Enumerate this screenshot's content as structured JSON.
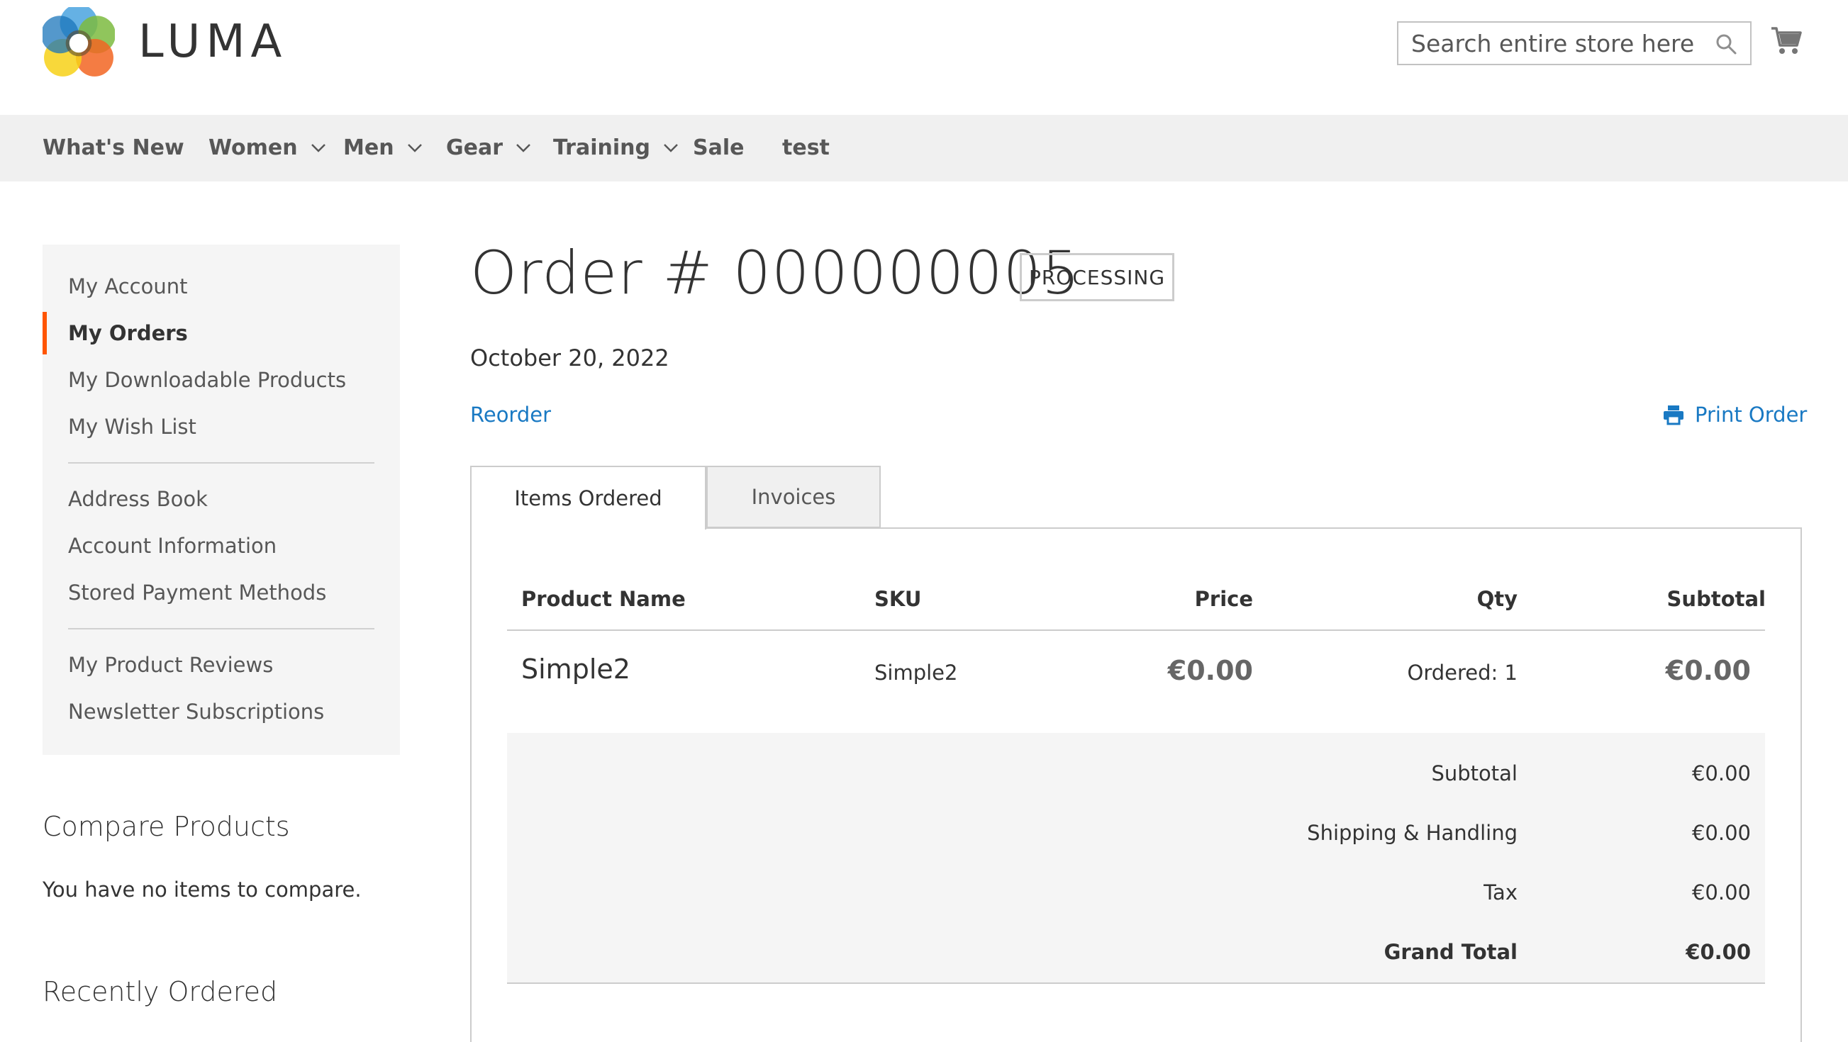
{
  "header": {
    "logo_text": "LUMA",
    "search_placeholder": "Search entire store here...",
    "search_icon": "search-icon",
    "cart_icon": "cart-icon"
  },
  "nav": {
    "items": [
      {
        "label": "What's New",
        "has_dropdown": false
      },
      {
        "label": "Women",
        "has_dropdown": true
      },
      {
        "label": "Men",
        "has_dropdown": true
      },
      {
        "label": "Gear",
        "has_dropdown": true
      },
      {
        "label": "Training",
        "has_dropdown": true
      },
      {
        "label": "Sale",
        "has_dropdown": false
      },
      {
        "label": "test",
        "has_dropdown": false
      }
    ]
  },
  "sidebar": {
    "items": [
      {
        "label": "My Account"
      },
      {
        "label": "My Orders",
        "active": true
      },
      {
        "label": "My Downloadable Products"
      },
      {
        "label": "My Wish List"
      },
      {
        "label": "Address Book"
      },
      {
        "label": "Account Information"
      },
      {
        "label": "Stored Payment Methods"
      },
      {
        "label": "My Product Reviews"
      },
      {
        "label": "Newsletter Subscriptions"
      }
    ],
    "active_color": "#ff5501"
  },
  "compare": {
    "title": "Compare Products",
    "text": "You have no items to compare."
  },
  "recent": {
    "title": "Recently Ordered"
  },
  "order": {
    "title": "Order # 000000005",
    "status": "PROCESSING",
    "date": "October 20, 2022",
    "reorder_label": "Reorder",
    "print_label": "Print Order",
    "print_icon": "printer-icon"
  },
  "tabs": [
    {
      "label": "Items Ordered",
      "active": true
    },
    {
      "label": "Invoices",
      "active": false
    }
  ],
  "table": {
    "headers": [
      "Product Name",
      "SKU",
      "Price",
      "Qty",
      "Subtotal"
    ],
    "rows": [
      {
        "name": "Simple2",
        "sku": "Simple2",
        "price": "€0.00",
        "qty": "Ordered: 1",
        "subtotal": "€0.00"
      }
    ]
  },
  "totals": [
    {
      "label": "Subtotal",
      "value": "€0.00"
    },
    {
      "label": "Shipping & Handling",
      "value": "€0.00"
    },
    {
      "label": "Tax",
      "value": "€0.00"
    },
    {
      "label": "Grand Total",
      "value": "€0.00",
      "strong": true
    }
  ],
  "colors": {
    "link": "#1979c3",
    "nav_bg": "#f0f0f0",
    "accent": "#ff5501"
  }
}
